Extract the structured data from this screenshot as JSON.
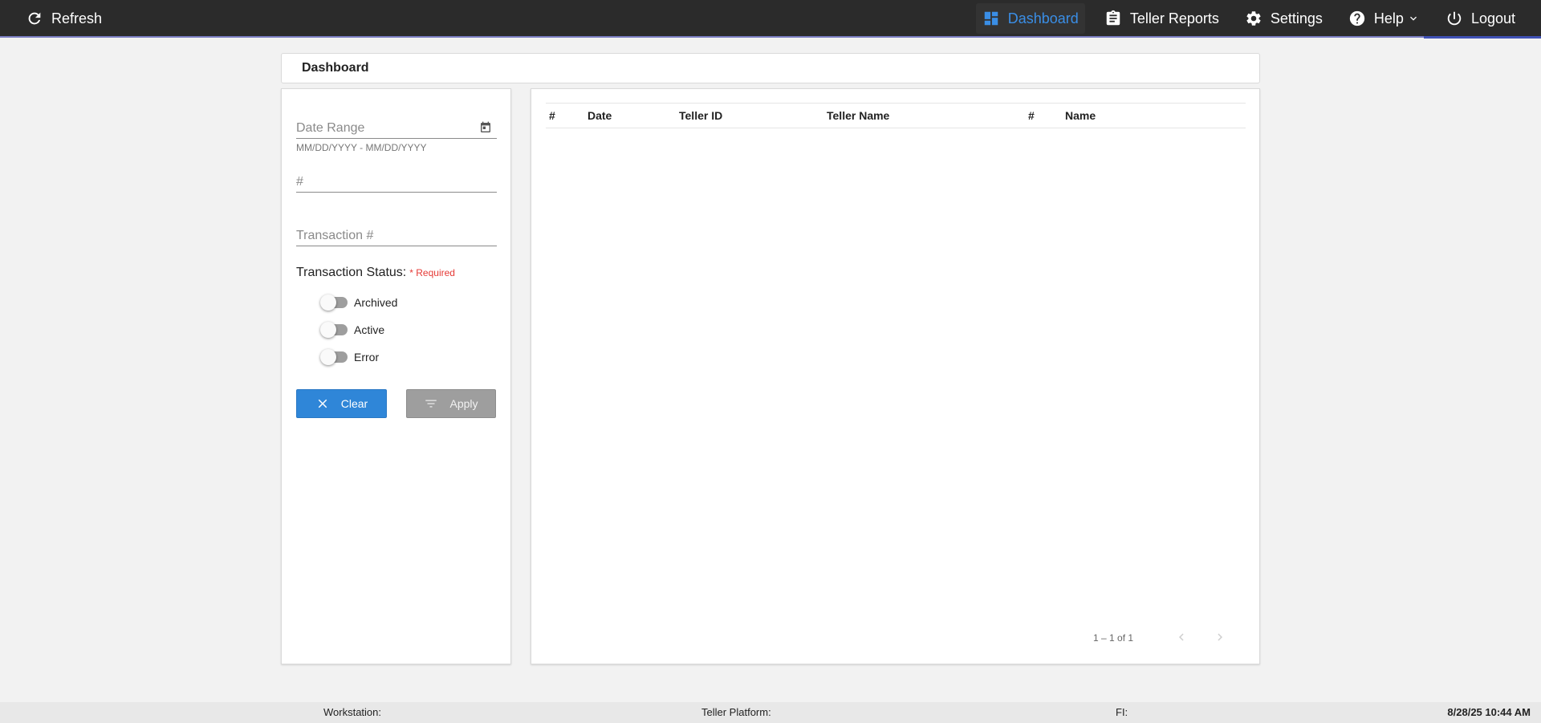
{
  "nav": {
    "refresh_label": "Refresh",
    "dashboard_label": "Dashboard",
    "teller_reports_label": "Teller Reports",
    "settings_label": "Settings",
    "help_label": "Help",
    "logout_label": "Logout",
    "accent_color": "#3a8ee6"
  },
  "page": {
    "title": "Dashboard"
  },
  "filters": {
    "date_range_placeholder": "Date Range",
    "date_range_hint": "MM/DD/YYYY - MM/DD/YYYY",
    "number_placeholder": "#",
    "transaction_placeholder": "Transaction #",
    "status_label": "Transaction Status:",
    "required_label": "* Required",
    "statuses": [
      {
        "label": "Archived",
        "checked": false
      },
      {
        "label": "Active",
        "checked": false
      },
      {
        "label": "Error",
        "checked": false
      }
    ],
    "clear_label": "Clear",
    "apply_label": "Apply"
  },
  "table": {
    "columns": [
      "#",
      "Date",
      "Teller ID",
      "Teller Name",
      "#",
      "Name"
    ],
    "rows": [],
    "pagination": "1 – 1 of 1"
  },
  "footer": {
    "workstation": "Workstation:",
    "teller_platform": "Teller Platform:",
    "fi": "FI:",
    "datetime": "8/28/25 10:44 AM"
  }
}
